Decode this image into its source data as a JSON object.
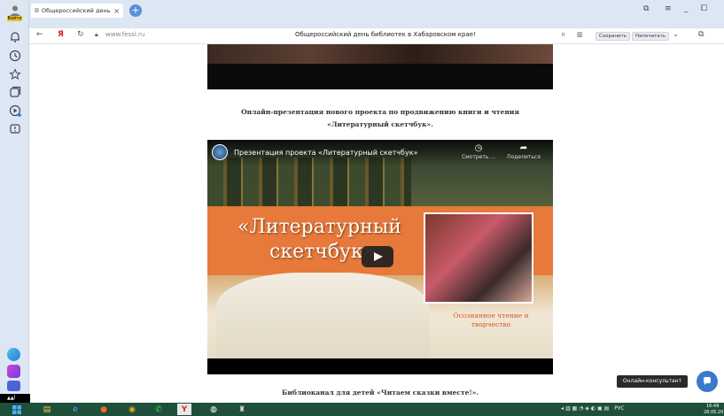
{
  "browser": {
    "tab_title": "Общероссийский день",
    "tab_close": "×",
    "new_tab": "+",
    "url": "www.fessl.ru",
    "page_title": "Общероссийский день библиотек в Хабаровском крае!",
    "save_label": "Сохранить",
    "print_label": "Напечатать",
    "login_label": "Войти"
  },
  "content": {
    "caption_line1": "Онлайн-презентация нового проекта по продвижению книги и чтения",
    "caption_line2": "«Литературный скетчбук».",
    "caption2": "Библиоканал для детей «Читаем сказки вместе!»."
  },
  "video": {
    "title": "Презентация проекта «Литературный скетчбук»",
    "watch_label": "Смотреть ...",
    "share_label": "Поделиться",
    "thumb_title_1": "«Литературный",
    "thumb_title_2": "скетчбук»",
    "thumb_subtitle": "Осознанное чтение и творчество"
  },
  "consultant": {
    "label": "Онлайн-консультант"
  },
  "taskbar": {
    "lang": "РУС",
    "time": "16:49",
    "date": "28.05.20"
  },
  "icons": {
    "windows": "windows-icon",
    "explorer": "folder-icon",
    "ie": "ie-icon",
    "yandex": "yandex-icon"
  }
}
